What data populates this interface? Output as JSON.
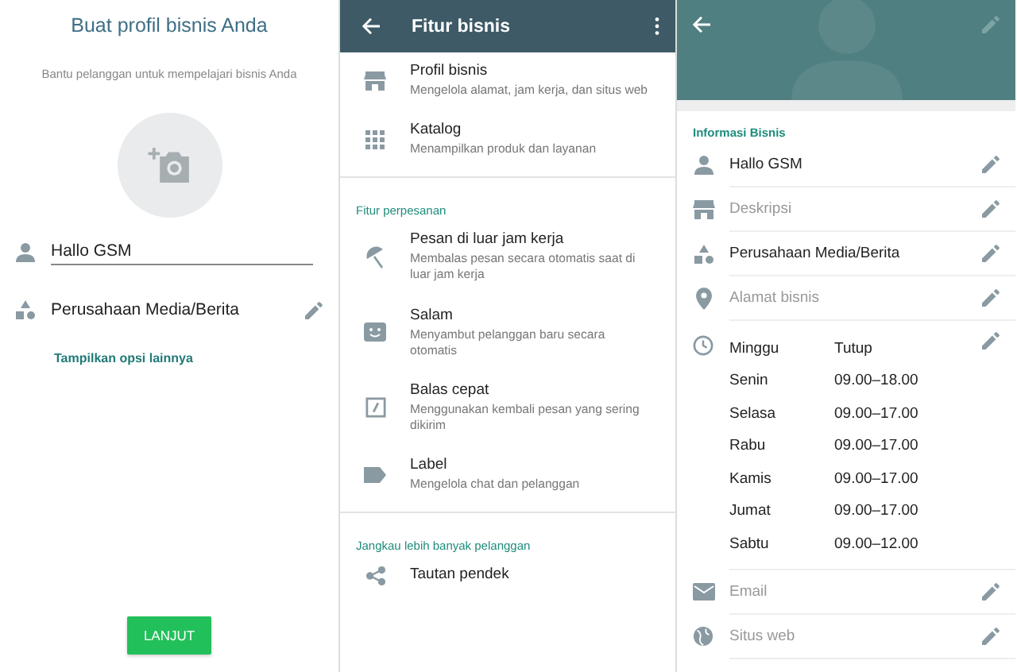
{
  "create_profile": {
    "title": "Buat profil bisnis Anda",
    "subtitle": "Bantu pelanggan untuk mempelajari bisnis Anda",
    "name_value": "Hallo GSM",
    "category": "Perusahaan Media/Berita",
    "more_link": "Tampilkan opsi lainnya",
    "next_button": "LANJUT"
  },
  "business_tools": {
    "title": "Fitur bisnis",
    "sections": [
      {
        "items": [
          {
            "kind": "store",
            "title": "Profil bisnis",
            "subtitle": "Mengelola alamat, jam kerja, dan situs web"
          },
          {
            "kind": "grid",
            "title": "Katalog",
            "subtitle": "Menampilkan produk dan layanan"
          }
        ]
      },
      {
        "heading": "Fitur perpesanan",
        "items": [
          {
            "kind": "away",
            "title": "Pesan di luar jam kerja",
            "subtitle": "Membalas pesan secara otomatis saat di luar jam kerja"
          },
          {
            "kind": "greeting",
            "title": "Salam",
            "subtitle": "Menyambut pelanggan baru secara otomatis"
          },
          {
            "kind": "quick",
            "title": "Balas cepat",
            "subtitle": "Menggunakan kembali pesan yang sering dikirim"
          },
          {
            "kind": "label",
            "title": "Label",
            "subtitle": "Mengelola chat dan pelanggan"
          }
        ]
      },
      {
        "heading": "Jangkau lebih banyak pelanggan",
        "items": [
          {
            "kind": "share",
            "title": "Tautan pendek"
          }
        ]
      }
    ]
  },
  "profile": {
    "section_title": "Informasi Bisnis",
    "fields": [
      {
        "kind": "person",
        "value": "Hallo GSM"
      },
      {
        "kind": "store",
        "placeholder": "Deskripsi"
      },
      {
        "kind": "category",
        "value": "Perusahaan Media/Berita"
      },
      {
        "kind": "pin",
        "placeholder": "Alamat bisnis"
      }
    ],
    "hours": [
      {
        "day": "Minggu",
        "time": "Tutup"
      },
      {
        "day": "Senin",
        "time": "09.00–18.00"
      },
      {
        "day": "Selasa",
        "time": "09.00–17.00"
      },
      {
        "day": "Rabu",
        "time": "09.00–17.00"
      },
      {
        "day": "Kamis",
        "time": "09.00–17.00"
      },
      {
        "day": "Jumat",
        "time": "09.00–17.00"
      },
      {
        "day": "Sabtu",
        "time": "09.00–12.00"
      }
    ],
    "contact_fields": [
      {
        "kind": "mail",
        "placeholder": "Email"
      },
      {
        "kind": "globe",
        "placeholder": "Situs web"
      }
    ]
  }
}
